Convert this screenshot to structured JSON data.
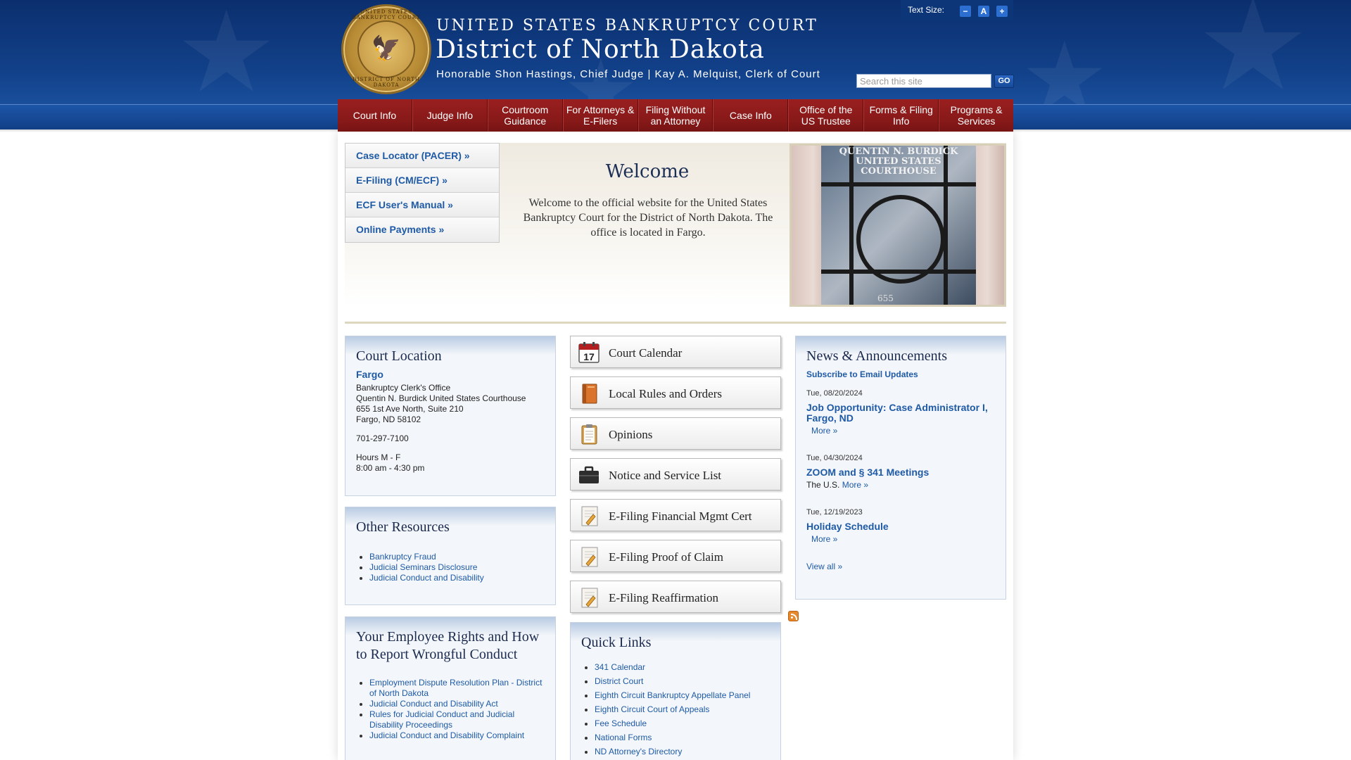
{
  "header": {
    "court_name": "UNITED STATES BANKRUPTCY COURT",
    "district_name": "District of North Dakota",
    "judges_line": "Honorable Shon Hastings, Chief Judge | Kay A. Melquist, Clerk of Court",
    "text_size_label": "Text Size:",
    "text_size_buttons": [
      "−",
      "A",
      "+"
    ],
    "search_placeholder": "Search this site",
    "search_button": "GO",
    "seal_text_top": "UNITED STATES BANKRUPTCY COURT",
    "seal_text_bottom": "DISTRICT OF NORTH DAKOTA"
  },
  "nav": [
    {
      "label": "Court Info"
    },
    {
      "label": "Judge Info"
    },
    {
      "label": "Courtroom Guidance"
    },
    {
      "label": "For Attorneys & E-Filers"
    },
    {
      "label": "Filing Without an Attorney"
    },
    {
      "label": "Case Info"
    },
    {
      "label": "Office of the US Trustee"
    },
    {
      "label": "Forms & Filing Info"
    },
    {
      "label": "Programs & Services"
    }
  ],
  "quick_buttons": [
    {
      "label": "Case Locator (PACER) »"
    },
    {
      "label": "E-Filing (CM/ECF) »"
    },
    {
      "label": "ECF User's Manual »"
    },
    {
      "label": "Online Payments »"
    }
  ],
  "welcome": {
    "title": "Welcome",
    "text": "Welcome to the official website for the United States Bankruptcy Court for the District of North Dakota. The office is located in Fargo."
  },
  "photo": {
    "caption_line1": "QUENTIN N. BURDICK",
    "caption_line2": "UNITED STATES COURTHOUSE",
    "number": "655"
  },
  "court_location": {
    "title": "Court Location",
    "city": "Fargo",
    "lines": [
      "Bankruptcy Clerk's Office",
      "Quentin N. Burdick United States Courthouse",
      "655 1st Ave North, Suite 210",
      "Fargo, ND 58102"
    ],
    "phone": "701-297-7100",
    "hours_line1": "Hours M - F",
    "hours_line2": "8:00 am - 4:30 pm"
  },
  "other_resources": {
    "title": "Other Resources",
    "items": [
      "Bankruptcy Fraud",
      "Judicial Seminars Disclosure",
      "Judicial Conduct and Disability"
    ]
  },
  "employee_rights": {
    "title": "Your Employee Rights and How to Report Wrongful Conduct",
    "items": [
      "Employment Dispute Resolution Plan - District of North Dakota",
      "Judicial Conduct and Disability Act",
      "Rules for Judicial Conduct and Judicial Disability Proceedings",
      "Judicial Conduct and Disability Complaint"
    ]
  },
  "icon_buttons": [
    {
      "label": "Court Calendar",
      "icon": "calendar-icon",
      "day": "17"
    },
    {
      "label": "Local Rules and Orders",
      "icon": "book-icon"
    },
    {
      "label": "Opinions",
      "icon": "clipboard-icon"
    },
    {
      "label": "Notice and Service List",
      "icon": "briefcase-icon"
    },
    {
      "label": "E-Filing Financial Mgmt Cert",
      "icon": "document-pencil-icon"
    },
    {
      "label": "E-Filing Proof of Claim",
      "icon": "document-pencil-icon"
    },
    {
      "label": "E-Filing Reaffirmation",
      "icon": "document-pencil-icon"
    }
  ],
  "quick_links": {
    "title": "Quick Links",
    "items": [
      "341 Calendar",
      "District Court",
      "Eighth Circuit Bankruptcy Appellate Panel",
      "Eighth Circuit Court of Appeals",
      "Fee Schedule",
      "National Forms",
      "ND Attorney's Directory"
    ]
  },
  "news": {
    "title": "News & Announcements",
    "subscribe": "Subscribe to Email Updates",
    "items": [
      {
        "date": "Tue, 08/20/2024",
        "title": "Job Opportunity: Case Administrator I, Fargo, ND",
        "teaser": "",
        "more": "More »"
      },
      {
        "date": "Tue, 04/30/2024",
        "title": "ZOOM and § 341 Meetings",
        "teaser": "The U.S.",
        "more": "More »"
      },
      {
        "date": "Tue, 12/19/2023",
        "title": "Holiday Schedule",
        "teaser": "",
        "more": "More »"
      }
    ],
    "view_all": "View all »"
  },
  "colors": {
    "header_blue": "#12418a",
    "nav_red": "#8b1a1a",
    "link_blue": "#1e5aa6",
    "rss_orange": "#e6882c"
  }
}
